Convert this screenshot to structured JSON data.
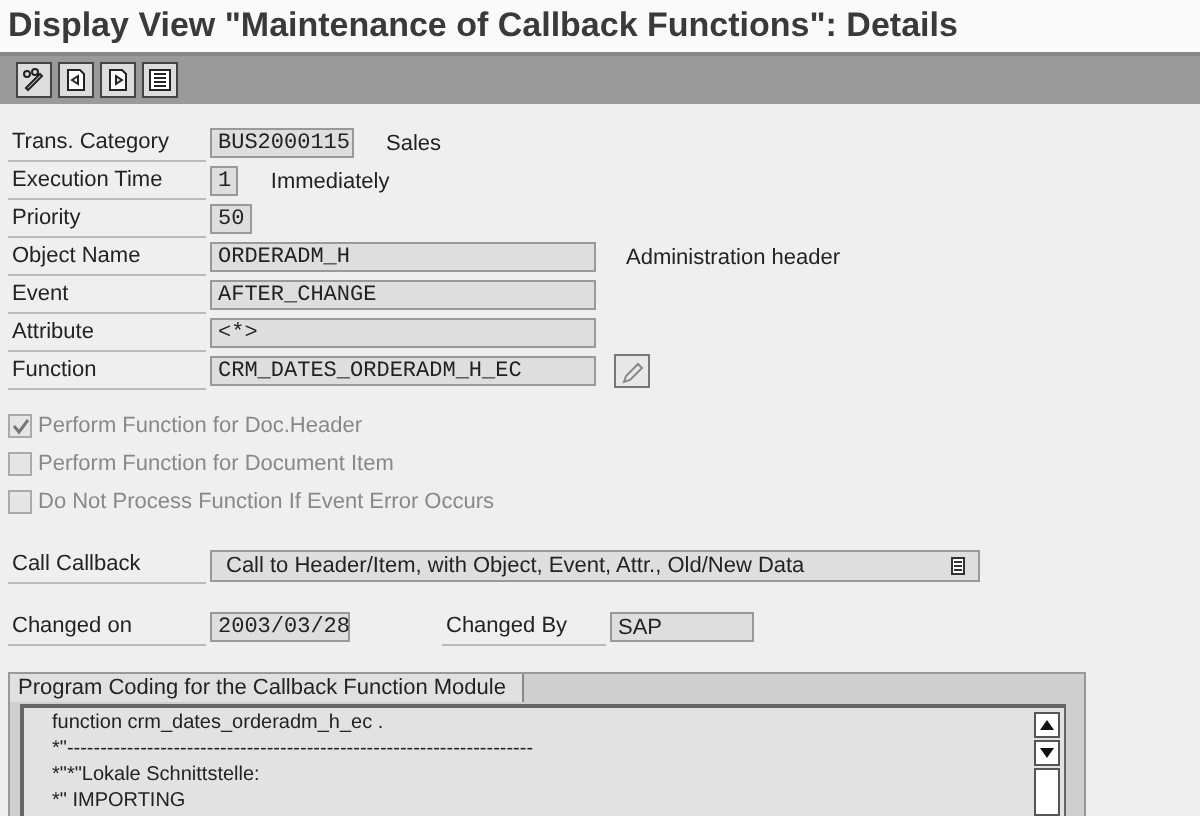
{
  "window": {
    "title": "Display View \"Maintenance of Callback Functions\": Details"
  },
  "toolbar": [
    {
      "kind": "pencil-glasses"
    },
    {
      "kind": "page-prev"
    },
    {
      "kind": "page-next"
    },
    {
      "kind": "list"
    }
  ],
  "fields": [
    {
      "label": "Trans. Category",
      "value": "BUS2000115",
      "kind": "short",
      "description": "Sales"
    },
    {
      "label": "Execution Time",
      "value": "1",
      "kind": "short",
      "description": "Immediately"
    },
    {
      "label": "Priority",
      "value": "50",
      "kind": "short"
    },
    {
      "label": "Object Name",
      "value": "ORDERADM_H",
      "kind": "long",
      "description": "Administration header"
    },
    {
      "label": "Event",
      "value": "AFTER_CHANGE",
      "kind": "long"
    },
    {
      "label": "Attribute",
      "value": "<*>",
      "kind": "long"
    },
    {
      "label": "Function",
      "value": "CRM_DATES_ORDERADM_H_EC",
      "kind": "long_button"
    }
  ],
  "checkboxes": [
    {
      "label": "Perform Function for Doc.Header",
      "checked": true,
      "disabled": true
    },
    {
      "label": "Perform Function for Document Item",
      "checked": false,
      "disabled": true
    },
    {
      "label": "Do Not Process Function If Event Error Occurs",
      "checked": false,
      "disabled": true
    }
  ],
  "call_callback": {
    "label": "Call Callback",
    "value": "Call to Header/Item, with Object, Event, Attr., Old/New Data"
  },
  "changed_on": {
    "label": "Changed on",
    "value": "2003/03/28"
  },
  "changed_by": {
    "label": "Changed By",
    "value": "SAP"
  },
  "code_panel": {
    "tab": "Program Coding for the Callback Function Module",
    "lines": [
      "function crm_dates_orderadm_h_ec .",
      "*\"----------------------------------------------------------------------",
      "*\"*\"Lokale Schnittstelle:",
      "*\"  IMPORTING"
    ]
  }
}
